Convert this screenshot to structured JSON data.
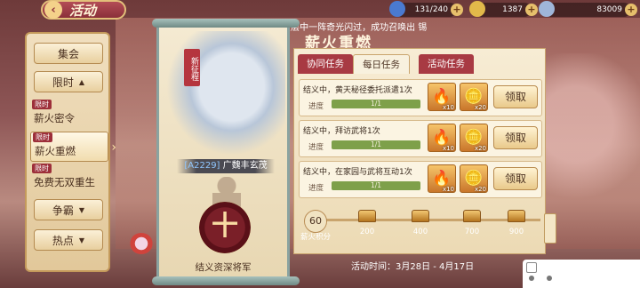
{
  "header": {
    "back_icon": "chevron-left-icon",
    "title": "活动",
    "resources": [
      {
        "icon": "stamina-icon",
        "value": "131/240",
        "color": "#4a7ad0"
      },
      {
        "icon": "gold-ingot-icon",
        "value": "1387",
        "color": "#e2b94a"
      },
      {
        "icon": "silver-coin-icon",
        "value": "83009",
        "color": "#9fb6d9"
      }
    ]
  },
  "announcement": "aoPZ召唤时，只见云层中一阵奇光闪过，成功召唤出 锡",
  "sidebar": {
    "items": [
      {
        "label": "集会"
      },
      {
        "label": "限时"
      },
      {
        "label": "争霸"
      },
      {
        "label": "热点"
      }
    ],
    "sub_items": [
      {
        "tag": "限时",
        "label": "薪火密令"
      },
      {
        "tag": "限时",
        "label": "薪火重燃"
      },
      {
        "tag": "限时",
        "label": "免费无双重生"
      }
    ]
  },
  "hero": {
    "new_tag": "新征程",
    "code": "[A2229]",
    "name": "广魏丰玄茂",
    "plus_symbol": "十",
    "caption": "结义资深将军"
  },
  "panel": {
    "title": "薪火重燃",
    "tabs": [
      "协同任务",
      "每日任务",
      "活动任务"
    ],
    "active_tab": 1,
    "tasks": [
      {
        "text": "结义中，黄天秘径委托派遣1次",
        "progress_label": "进度",
        "progress_text": "1/1",
        "progress": 1.0,
        "rewards": [
          {
            "icon": "fire-icon",
            "count": "x10"
          },
          {
            "icon": "gold-ingot-icon",
            "count": "x20"
          }
        ],
        "claim": "领取"
      },
      {
        "text": "结义中，拜访武将1次",
        "progress_label": "进度",
        "progress_text": "1/1",
        "progress": 1.0,
        "rewards": [
          {
            "icon": "fire-icon",
            "count": "x10"
          },
          {
            "icon": "gold-ingot-icon",
            "count": "x20"
          }
        ],
        "claim": "领取"
      },
      {
        "text": "结义中，在家园与武将互动1次",
        "progress_label": "进度",
        "progress_text": "1/1",
        "progress": 1.0,
        "rewards": [
          {
            "icon": "fire-icon",
            "count": "x10"
          },
          {
            "icon": "gold-ingot-icon",
            "count": "x20"
          }
        ],
        "claim": "领取"
      }
    ]
  },
  "points": {
    "current": "60",
    "label": "薪火积分",
    "milestones": [
      "200",
      "400",
      "700",
      "900"
    ]
  },
  "event_time": "活动时间：3月28日 - 4月17日"
}
